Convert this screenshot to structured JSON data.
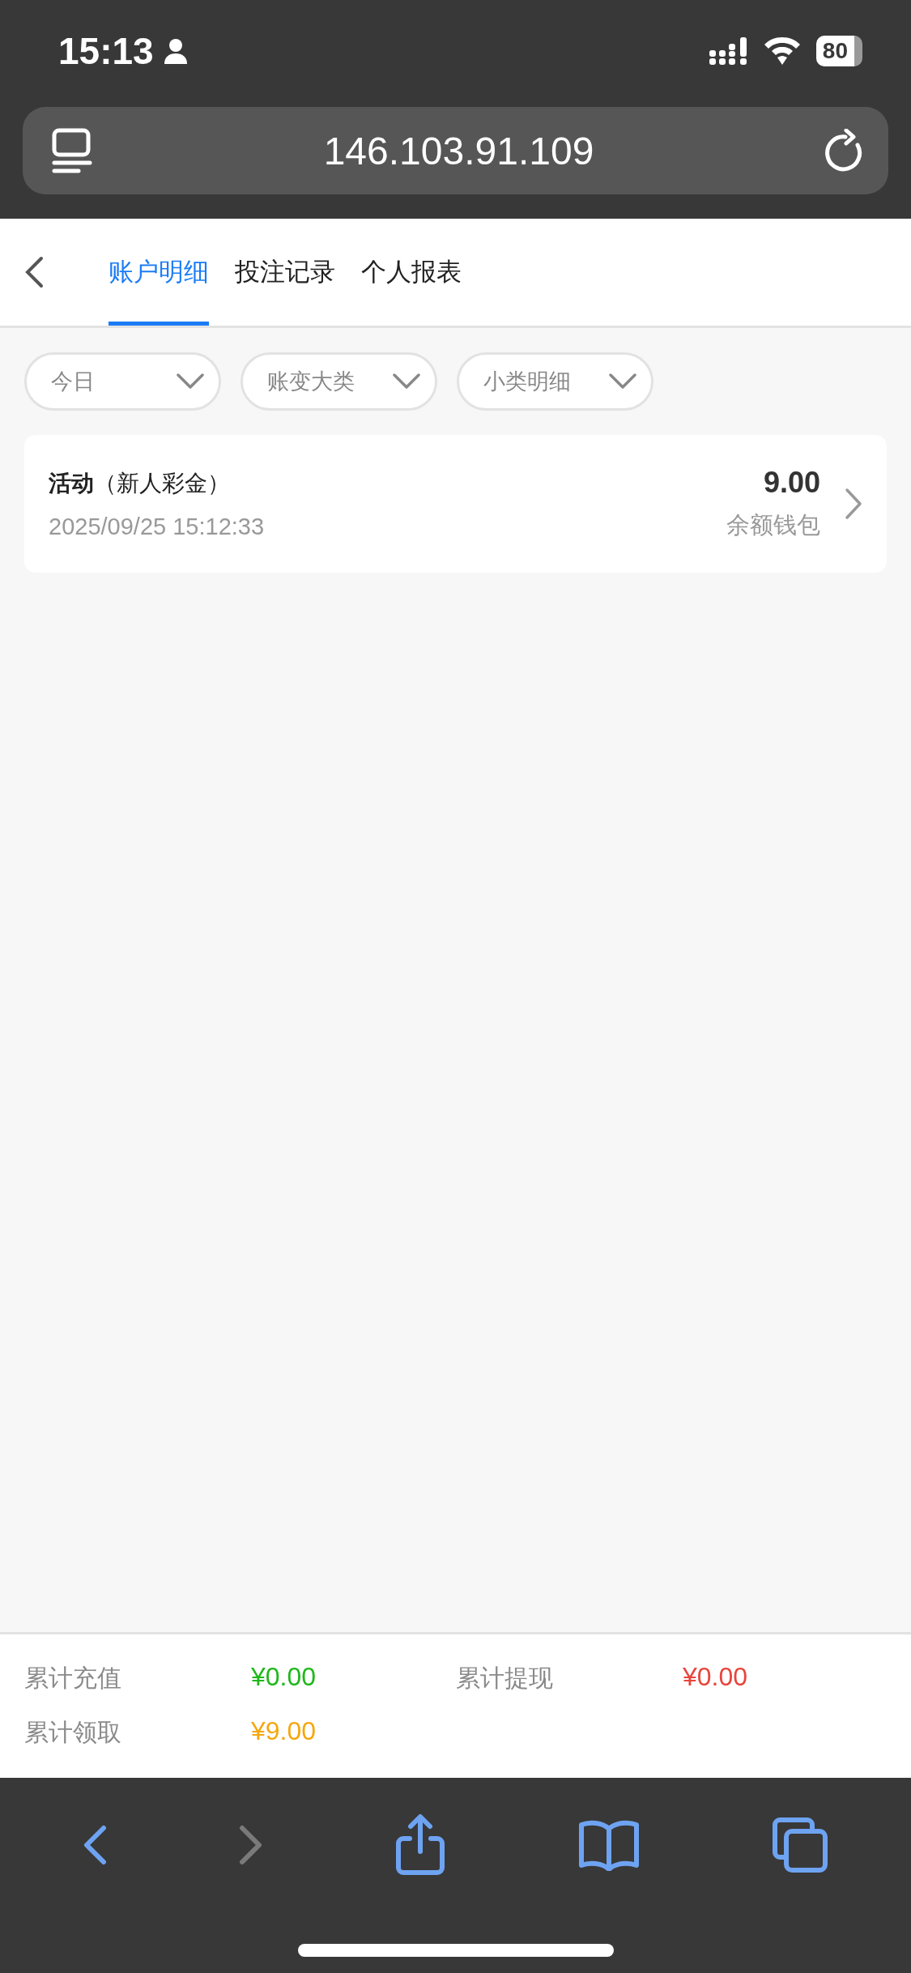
{
  "status_bar": {
    "time": "15:13",
    "battery": "80"
  },
  "browser": {
    "address": "146.103.91.109"
  },
  "tabs": [
    {
      "label": "账户明细",
      "selected": true
    },
    {
      "label": "投注记录",
      "selected": false
    },
    {
      "label": "个人报表",
      "selected": false
    }
  ],
  "filters": [
    {
      "label": "今日"
    },
    {
      "label": "账变大类"
    },
    {
      "label": "小类明细"
    }
  ],
  "records": [
    {
      "title": "**活动**（新人彩金）",
      "time": "2025/09/25 15:12:33",
      "amount": "9.00",
      "wallet": "余额钱包"
    }
  ],
  "summary": [
    {
      "label": "累计充值",
      "value": "¥0.00",
      "color": "#1fb81b"
    },
    {
      "label": "累计提现",
      "value": "¥0.00",
      "color": "#e8453c"
    },
    {
      "label": "累计领取",
      "value": "¥9.00",
      "color": "#f5a70f"
    }
  ],
  "toolbar": [
    {
      "kind": "back",
      "disabled": false
    },
    {
      "kind": "forward",
      "disabled": true
    },
    {
      "kind": "share",
      "disabled": false
    },
    {
      "kind": "bookmarks",
      "disabled": false
    },
    {
      "kind": "tabs",
      "disabled": false
    }
  ]
}
